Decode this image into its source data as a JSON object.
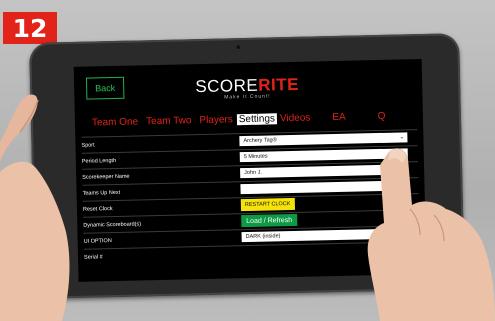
{
  "step_badge": "12",
  "back_label": "Back",
  "logo": {
    "score": "SCORE",
    "rite": "RITE",
    "tagline": "Make It Count!"
  },
  "tabs": [
    {
      "label": "Team One"
    },
    {
      "label": "Team Two"
    },
    {
      "label": "Players"
    },
    {
      "label": "Settings",
      "active": true
    },
    {
      "label": "Videos"
    },
    {
      "label": "EA"
    },
    {
      "label": "Q"
    }
  ],
  "settings": {
    "sport": {
      "label": "Sport",
      "value": "Archery Tag®"
    },
    "period_length": {
      "label": "Period Length",
      "value": "5 Minutes"
    },
    "scorekeeper": {
      "label": "Scorekeeper Name",
      "value": "John J."
    },
    "teams_up_next": {
      "label": "Teams Up Next",
      "value": ""
    },
    "reset_clock": {
      "label": "Reset Clock",
      "button": "RESTART CLOCK"
    },
    "dynamic_scoreboard": {
      "label": "Dynamic Scoreboard(s)",
      "button": "Load / Refresh"
    },
    "ui_option": {
      "label": "UI OPTION",
      "value": "DARK (inside)"
    },
    "serial": {
      "label": "Serial #"
    }
  },
  "colors": {
    "accent_red": "#e2231a",
    "green": "#0e9a45",
    "yellow": "#f5e20a",
    "screen_bg": "#000000"
  },
  "icons": [
    "chevron-down-icon"
  ]
}
